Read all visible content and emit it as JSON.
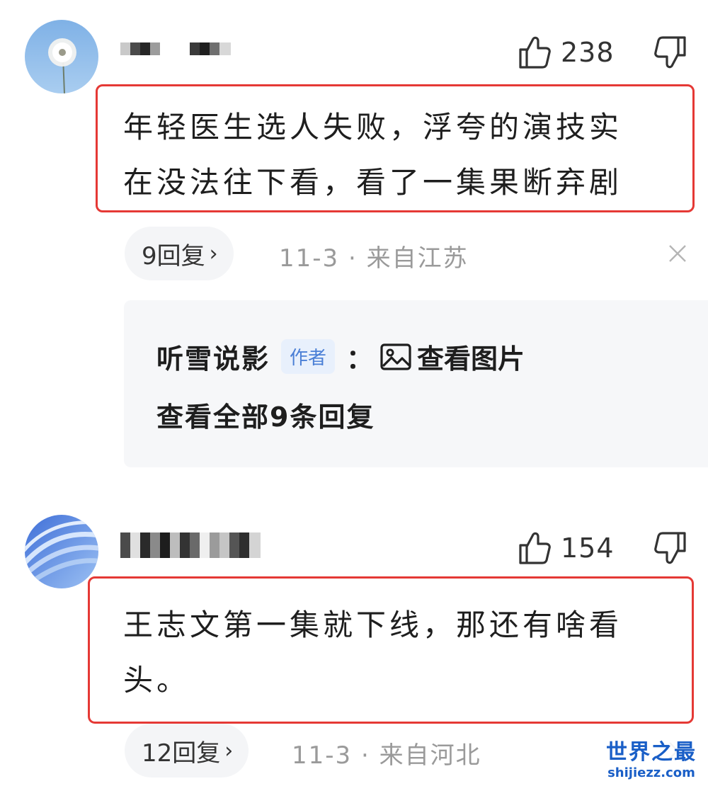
{
  "comments": [
    {
      "like_count": "238",
      "text": "年轻医生选人失败，浮夸的演技实\n在没法往下看，看了一集果断弃剧",
      "reply_count_label": "9回复",
      "meta": "11-3 · 来自江苏",
      "sub_reply": {
        "author": "听雪说影",
        "badge": "作者",
        "colon": "：",
        "content": "查看图片",
        "view_all": "查看全部9条回复"
      }
    },
    {
      "like_count": "154",
      "text": "王志文第一集就下线，那还有啥看\n头。",
      "reply_count_label": "12回复",
      "meta": "11-3 · 来自河北"
    }
  ],
  "icons": {
    "like": "thumbs-up-icon",
    "dislike": "thumbs-down-icon",
    "chevron": "chevron-right-icon",
    "close": "close-icon",
    "image": "image-icon"
  },
  "colors": {
    "highlight_border": "#e53935",
    "meta_text": "#9a9a9a",
    "author_badge": "#4a7fd6",
    "watermark": "#1a5fc7"
  },
  "watermark": {
    "cn": "世界之最",
    "en": "shijiezz.com"
  }
}
